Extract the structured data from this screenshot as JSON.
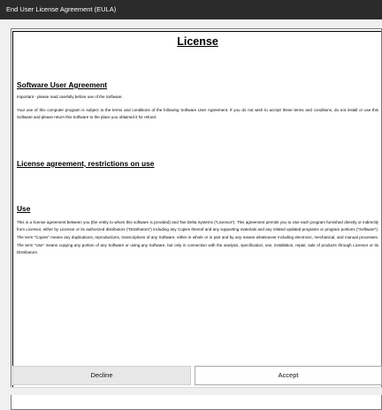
{
  "window": {
    "title": "End User License Agreement (EULA)"
  },
  "document": {
    "heading": "License",
    "sections": [
      {
        "title": "Software User Agreement",
        "paragraphs": [
          "Important - please read carefully before use of the Software.",
          "Your use of this computer program is subject to the terms and conditions of the following Software User Agreement. If you do not wish to accept these terms and conditions, do not install or use this Software and please return this Software to the place you obtained it for refund."
        ]
      },
      {
        "title": "License agreement, restrictions on use",
        "paragraphs": []
      },
      {
        "title": "Use",
        "paragraphs": [
          "This is a license agreement between you (the entity to whom this software is provided) and Tan Delta Systems (“Licensor”). This agreement permits you to Use each program furnished directly or indirectly from Licensor, either by Licensor or its authorized distributors (“Distributors”) including any Copies thereof and any supporting materials and any related updated programs or program portions (“Software”). The term “Copies” means any duplications, reproductions, transcriptions of any Software, either in whole or in part and by any means whatsoever including electronic, mechanical, and manual processes. The term “Use” means copying any portion of any Software or using any Software, but only in connection with the analysis, specification, use, installation, repair, sale of products through Licensor or its Distributors."
        ]
      }
    ]
  },
  "buttons": {
    "decline": "Decline",
    "accept": "Accept"
  }
}
